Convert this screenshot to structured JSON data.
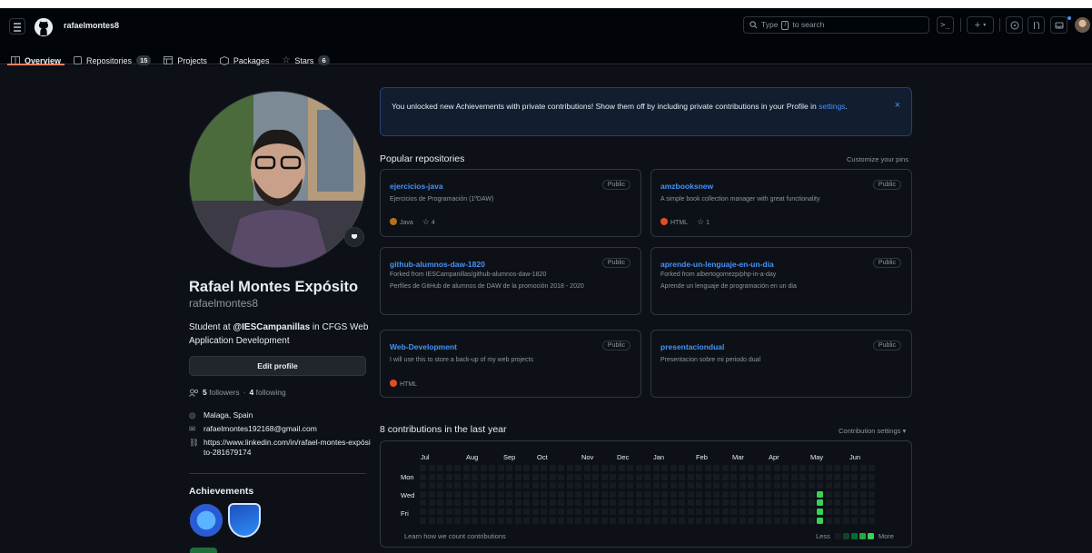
{
  "header": {
    "username": "rafaelmontes8",
    "search_placeholder_prefix": "Type",
    "search_key": "/",
    "search_placeholder_suffix": "to search"
  },
  "tabs": [
    {
      "label": "Overview"
    },
    {
      "label": "Repositories",
      "count": "15"
    },
    {
      "label": "Projects"
    },
    {
      "label": "Packages"
    },
    {
      "label": "Stars",
      "count": "6"
    }
  ],
  "profile": {
    "name": "Rafael Montes Expósito",
    "login": "rafaelmontes8",
    "bio_prefix": "Student at ",
    "bio_org": "@IESCampanillas",
    "bio_suffix": " in CFGS Web Application Development",
    "edit_label": "Edit profile",
    "followers_count": "5",
    "followers_label": "followers",
    "sep": "·",
    "following_count": "4",
    "following_label": "following",
    "location": "Malaga, Spain",
    "email": "rafaelmontes192168@gmail.com",
    "website": "https://www.linkedin.com/in/rafael-montes-expósito-281679174",
    "achievements_title": "Achievements"
  },
  "banner": {
    "text": "You unlocked new Achievements with private contributions! Show them off by including private contributions in your Profile in",
    "link": "settings",
    "end": ".",
    "close": "×"
  },
  "popular": {
    "title": "Popular repositories",
    "customize": "Customize your pins",
    "repos": [
      {
        "name": "ejercicios-java",
        "visibility": "Public",
        "fork": "",
        "desc": "Ejercicios de Programación (1ºDAW)",
        "lang": "Java",
        "lang_color": "#b07219",
        "stars": "4"
      },
      {
        "name": "amzbooksnew",
        "visibility": "Public",
        "fork": "",
        "desc": "A simple book collection manager with great functionality",
        "lang": "HTML",
        "lang_color": "#e34c26",
        "stars": "1"
      },
      {
        "name": "github-alumnos-daw-1820",
        "visibility": "Public",
        "fork": "Forked from IESCampanillas/github-alumnos-daw-1820",
        "desc": "Perfiles de GitHub de alumnos de DAW de la promoción 2018 - 2020",
        "lang": "",
        "lang_color": "",
        "stars": ""
      },
      {
        "name": "aprende-un-lenguaje-en-un-dia",
        "visibility": "Public",
        "fork": "Forked from albertogomezp/php-in-a-day",
        "desc": "Aprende un lenguaje de programación en un dia",
        "lang": "",
        "lang_color": "",
        "stars": ""
      },
      {
        "name": "Web-Development",
        "visibility": "Public",
        "fork": "",
        "desc": "I will use this to store a back-up of my web projects",
        "lang": "HTML",
        "lang_color": "#e34c26",
        "stars": ""
      },
      {
        "name": "presentaciondual",
        "visibility": "Public",
        "fork": "",
        "desc": "Presentacion sobre mi periodo dual",
        "lang": "",
        "lang_color": "",
        "stars": ""
      }
    ]
  },
  "contributions": {
    "title": "8 contributions in the last year",
    "settings": "Contribution settings ▾",
    "months": [
      "Jul",
      "Aug",
      "Sep",
      "Oct",
      "Nov",
      "Dec",
      "Jan",
      "Feb",
      "Mar",
      "Apr",
      "May",
      "Jun"
    ],
    "days": [
      "Mon",
      "Wed",
      "Fri"
    ],
    "learn": "Learn how we count contributions",
    "less": "Less",
    "more": "More",
    "active_color": "#39d353",
    "empty_color": "#161b22",
    "active_cells": [
      [
        46,
        3
      ],
      [
        46,
        4
      ],
      [
        46,
        5
      ],
      [
        46,
        6
      ],
      [
        46,
        7
      ]
    ]
  }
}
